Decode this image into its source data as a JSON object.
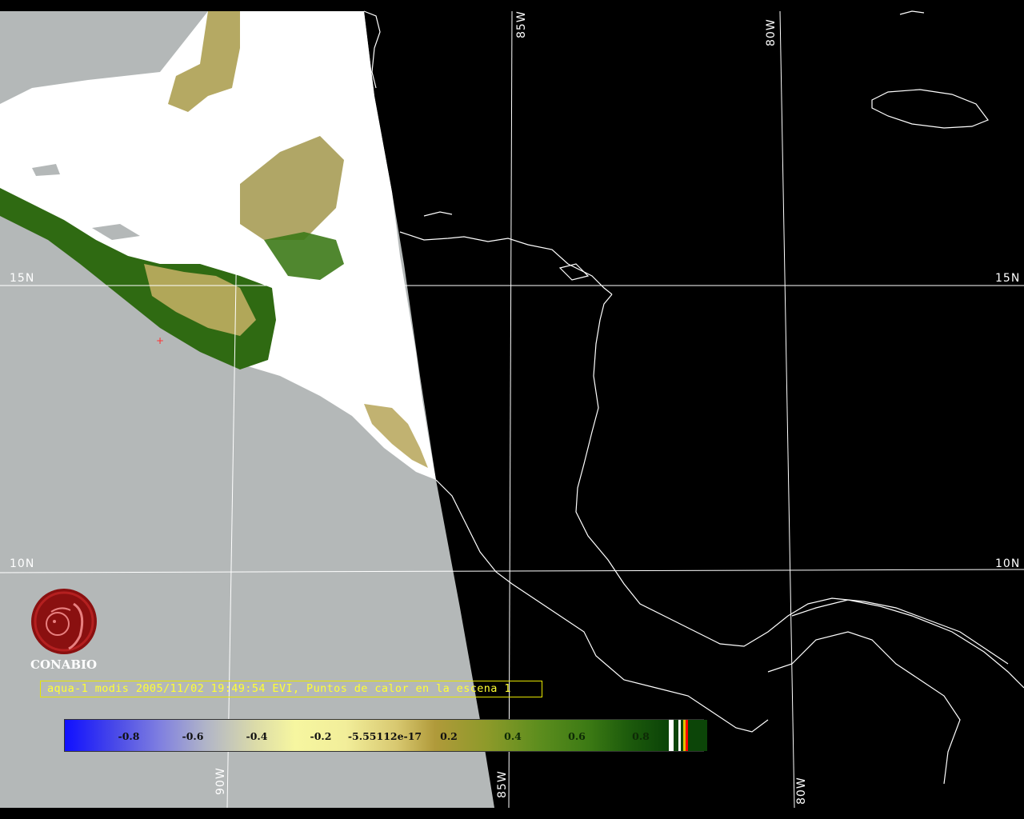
{
  "map": {
    "colors": {
      "background": "#000000",
      "no_data": "#b4b8b8",
      "cloud": "#ffffff",
      "vegetation": "#2f6a12",
      "coastline": "#ffffff",
      "graticule": "#ffffff",
      "caption": "#ffff33",
      "logo": "#8a1010"
    },
    "graticule_labels": {
      "lat_15_left": "15N",
      "lat_15_right": "15N",
      "lat_10_left": "10N",
      "lat_10_right": "10N",
      "lon_85_top": "85W",
      "lon_80_top": "80W",
      "lon_90_bottom": "90W",
      "lon_85_bottom": "85W",
      "lon_80_bottom": "80W"
    }
  },
  "logo": {
    "icon": "conabio-macaw-seal-icon",
    "text": "CONABIO"
  },
  "caption": "aqua-1 modis 2005/11/02 19:49:54 EVI, Puntos de calor en la escena 1",
  "colorbar": {
    "ticks": [
      "-0.8",
      "-0.6",
      "-0.4",
      "-0.2",
      "-5.55112e-17",
      "0.2",
      "0.4",
      "0.6",
      "0.8"
    ],
    "end_colors": [
      "#ffffff",
      "#0c4508",
      "#ffffff",
      "#0c4508",
      "#e0c000",
      "#ff0000",
      "#0c4508"
    ]
  }
}
